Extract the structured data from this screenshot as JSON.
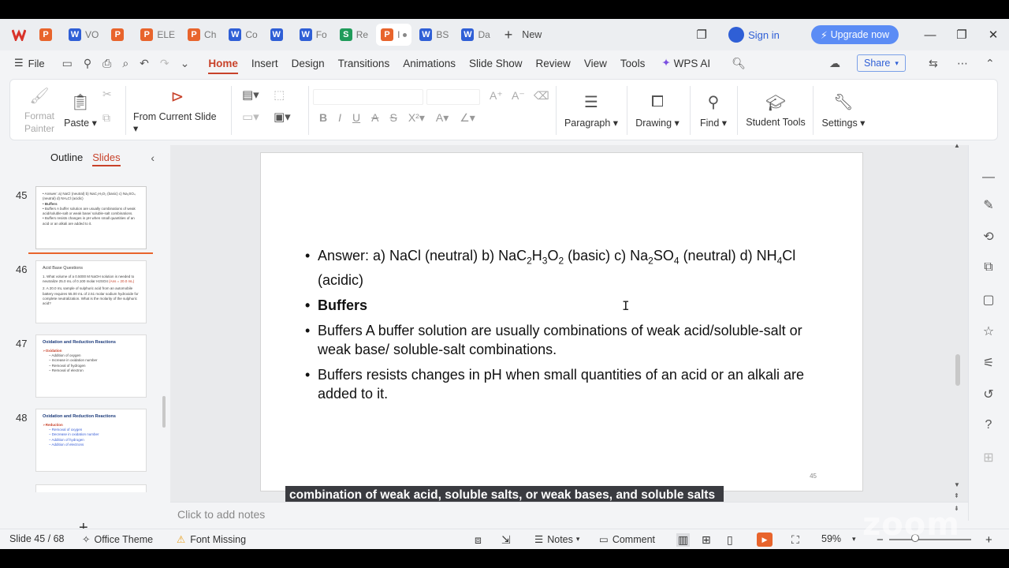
{
  "tabs": [
    {
      "label": "",
      "type": "p"
    },
    {
      "label": "VO",
      "type": "w"
    },
    {
      "label": "",
      "type": "p"
    },
    {
      "label": "ELE",
      "type": "p"
    },
    {
      "label": "Ch",
      "type": "p"
    },
    {
      "label": "Co",
      "type": "w"
    },
    {
      "label": "",
      "type": "w"
    },
    {
      "label": "Fo",
      "type": "w"
    },
    {
      "label": "Re",
      "type": "s"
    },
    {
      "label": "I",
      "type": "p",
      "active": true
    },
    {
      "label": "BS",
      "type": "w"
    },
    {
      "label": "Da",
      "type": "w"
    }
  ],
  "titlebar": {
    "new_tab": "New",
    "signin": "Sign in",
    "upgrade": "Upgrade now"
  },
  "menu": {
    "file": "File",
    "items": [
      "Home",
      "Insert",
      "Design",
      "Transitions",
      "Animations",
      "Slide Show",
      "Review",
      "View",
      "Tools"
    ],
    "wps_ai": "WPS AI",
    "share": "Share"
  },
  "ribbon": {
    "format_painter": "Format Painter",
    "paste": "Paste",
    "from_current_slide": "From Current Slide",
    "paragraph": "Paragraph",
    "drawing": "Drawing",
    "find": "Find",
    "student_tools": "Student Tools",
    "settings": "Settings"
  },
  "left_panel": {
    "tab_outline": "Outline",
    "tab_slides": "Slides",
    "thumbnails": [
      {
        "num": "45"
      },
      {
        "num": "46",
        "title": "Acid Base Questions"
      },
      {
        "num": "47",
        "title": "Oxidation and Reduction Reactions",
        "sub": "Oxidation",
        "items": [
          "Addition of oxygen",
          "Increase in oxidation number",
          "Removal of hydrogen",
          "Removal of electron"
        ]
      },
      {
        "num": "48",
        "title": "Oxidation and Reduction Reactions",
        "sub": "Reduction",
        "items": [
          "Removal of oxygen",
          "Decrease in oxidation number",
          "Addition of hydrogen",
          "Addition of electrons"
        ]
      }
    ]
  },
  "slide": {
    "buffers_heading": "Buffers",
    "bullet3": "Buffers A buffer solution are usually combinations of weak acid/soluble-salt or weak base/ soluble-salt combinations.",
    "bullet4": " Buffers resists changes in pH when small quantities of an acid or an alkali are added to it.",
    "page_number": "45"
  },
  "caption": "combination of weak acid, soluble salts, or weak bases, and soluble salts combinations.",
  "notes_placeholder": "Click to add notes",
  "status": {
    "slide_info": "Slide 45 / 68",
    "theme": "Office Theme",
    "font_missing": "Font Missing",
    "notes": "Notes",
    "comment": "Comment",
    "zoom": "59%"
  },
  "watermark": "zoom"
}
